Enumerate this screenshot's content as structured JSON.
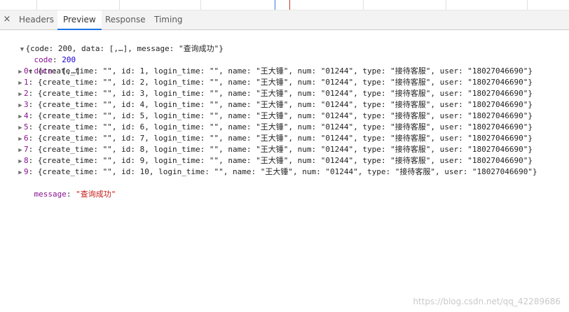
{
  "tabs": {
    "close_glyph": "×",
    "items": [
      {
        "label": "Headers",
        "active": false
      },
      {
        "label": "Preview",
        "active": true
      },
      {
        "label": "Response",
        "active": false
      },
      {
        "label": "Timing",
        "active": false
      }
    ]
  },
  "preview": {
    "root_summary": "{code: 200, data: [,…], message: \"查询成功\"}",
    "code_key": "code",
    "code_value": "200",
    "data_key": "data",
    "data_summary": "[,…]",
    "rows": [
      {
        "idx": "0",
        "rest_pre": "{create_time: \"\", id: ",
        "id": "1",
        "rest_post": ", login_time: \"\", name: \"王大锤\", num: \"01244\", type: \"接待客服\", user: \"18027046690\"}"
      },
      {
        "idx": "1",
        "rest_pre": "{create_time: \"\", id: ",
        "id": "2",
        "rest_post": ", login_time: \"\", name: \"王大锤\", num: \"01244\", type: \"接待客服\", user: \"18027046690\"}"
      },
      {
        "idx": "2",
        "rest_pre": "{create_time: \"\", id: ",
        "id": "3",
        "rest_post": ", login_time: \"\", name: \"王大锤\", num: \"01244\", type: \"接待客服\", user: \"18027046690\"}"
      },
      {
        "idx": "3",
        "rest_pre": "{create_time: \"\", id: ",
        "id": "4",
        "rest_post": ", login_time: \"\", name: \"王大锤\", num: \"01244\", type: \"接待客服\", user: \"18027046690\"}"
      },
      {
        "idx": "4",
        "rest_pre": "{create_time: \"\", id: ",
        "id": "5",
        "rest_post": ", login_time: \"\", name: \"王大锤\", num: \"01244\", type: \"接待客服\", user: \"18027046690\"}"
      },
      {
        "idx": "5",
        "rest_pre": "{create_time: \"\", id: ",
        "id": "6",
        "rest_post": ", login_time: \"\", name: \"王大锤\", num: \"01244\", type: \"接待客服\", user: \"18027046690\"}"
      },
      {
        "idx": "6",
        "rest_pre": "{create_time: \"\", id: ",
        "id": "7",
        "rest_post": ", login_time: \"\", name: \"王大锤\", num: \"01244\", type: \"接待客服\", user: \"18027046690\"}"
      },
      {
        "idx": "7",
        "rest_pre": "{create_time: \"\", id: ",
        "id": "8",
        "rest_post": ", login_time: \"\", name: \"王大锤\", num: \"01244\", type: \"接待客服\", user: \"18027046690\"}"
      },
      {
        "idx": "8",
        "rest_pre": "{create_time: \"\", id: ",
        "id": "9",
        "rest_post": ", login_time: \"\", name: \"王大锤\", num: \"01244\", type: \"接待客服\", user: \"18027046690\"}"
      },
      {
        "idx": "9",
        "rest_pre": "{create_time: \"\", id: ",
        "id": "10",
        "rest_post": ", login_time: \"\", name: \"王大锤\", num: \"01244\", type: \"接待客服\", user: \"18027046690\"}"
      }
    ],
    "message_key": "message",
    "message_value": "\"查询成功\""
  },
  "icons": {
    "expanded": "▼",
    "collapsed": "▶"
  },
  "colors": {
    "key": "#881391",
    "number": "#1c00cf",
    "string": "#c41a16",
    "active_tab_underline": "#1a73e8"
  },
  "watermark": "https://blog.csdn.net/qq_42289686"
}
